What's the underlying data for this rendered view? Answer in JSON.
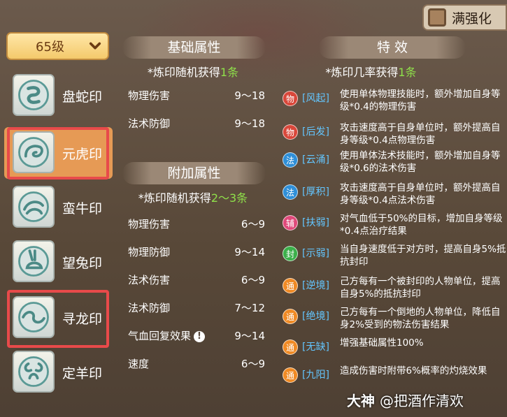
{
  "top_check": {
    "label": "满强化"
  },
  "level_select": {
    "value": "65级"
  },
  "seals": [
    {
      "name": "盘蛇印",
      "active": false,
      "highlight": false
    },
    {
      "name": "元虎印",
      "active": true,
      "highlight": true
    },
    {
      "name": "蛮牛印",
      "active": false,
      "highlight": false
    },
    {
      "name": "望兔印",
      "active": false,
      "highlight": false
    },
    {
      "name": "寻龙印",
      "active": false,
      "highlight": true
    },
    {
      "name": "定羊印",
      "active": false,
      "highlight": false
    }
  ],
  "base": {
    "title": "基础属性",
    "sub_prefix": "*炼印随机获得",
    "sub_count": "1条",
    "attrs": [
      {
        "name": "物理伤害",
        "value": "9～18"
      },
      {
        "name": "法术防御",
        "value": "9～18"
      }
    ]
  },
  "extra": {
    "title": "附加属性",
    "sub_prefix": "*炼印随机获得",
    "sub_count": "2～3条",
    "attrs": [
      {
        "name": "物理伤害",
        "value": "6～9"
      },
      {
        "name": "物理防御",
        "value": "9～14"
      },
      {
        "name": "法术伤害",
        "value": "6～9"
      },
      {
        "name": "法术防御",
        "value": "7～12"
      },
      {
        "name": "气血回复效果",
        "value": "9～14"
      },
      {
        "name": "速度",
        "value": "6～9"
      }
    ]
  },
  "special": {
    "title": "特 效",
    "sub_prefix": "*炼印几率获得",
    "sub_count": "1条",
    "effects": [
      {
        "badge": "物",
        "color": "#d9473a",
        "tag": "[风起]",
        "desc": "使用单体物理技能时，额外增加自身等级*0.4的物理伤害"
      },
      {
        "badge": "物",
        "color": "#d9473a",
        "tag": "[后发]",
        "desc": "攻击速度高于自身单位时，额外提高自身等级*0.4点物理伤害"
      },
      {
        "badge": "法",
        "color": "#2f8fd8",
        "tag": "[云涌]",
        "desc": "使用单体法术技能时，额外增加自身等级*0.6的法术伤害"
      },
      {
        "badge": "法",
        "color": "#2f8fd8",
        "tag": "[厚积]",
        "desc": "攻击速度高于自身单位时，额外提高自身等级*0.4点法术伤害"
      },
      {
        "badge": "辅",
        "color": "#e0497a",
        "tag": "[扶弱]",
        "desc": "对气血低于50%的目标，增加自身等级*0.4点治疗结果"
      },
      {
        "badge": "封",
        "color": "#3bb04a",
        "tag": "[示弱]",
        "desc": "当自身速度低于对方时，提高自身5%抵抗封印"
      },
      {
        "badge": "通",
        "color": "#f08a24",
        "tag": "[逆境]",
        "desc": "己方每有一个被封印的人物单位，提高自身5%的抵抗封印"
      },
      {
        "badge": "通",
        "color": "#f08a24",
        "tag": "[绝境]",
        "desc": "己方每有一个倒地的人物单位，降低自身2%受到的物法伤害结果"
      },
      {
        "badge": "通",
        "color": "#f08a24",
        "tag": "[无缺]",
        "desc": "增强基础属性100%"
      },
      {
        "badge": "通",
        "color": "#f08a24",
        "tag": "[九阳]",
        "desc": "造成伤害时附带6%概率的灼烧效果"
      }
    ]
  },
  "watermark": {
    "brand": "大神",
    "user": "@把酒作清欢"
  }
}
